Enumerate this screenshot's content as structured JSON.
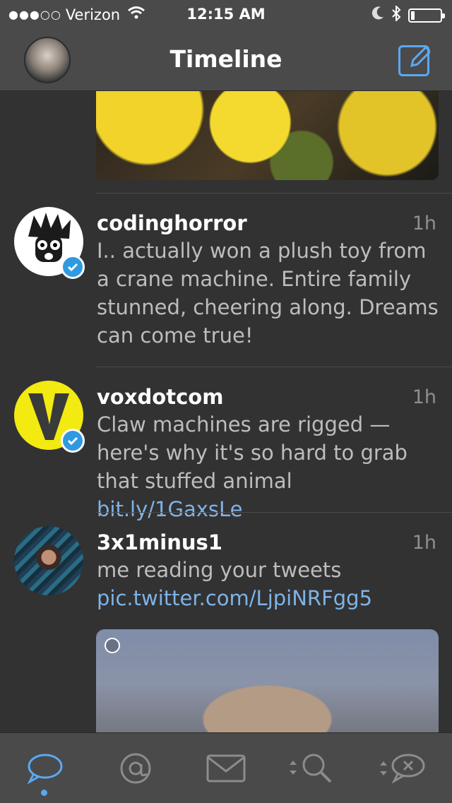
{
  "status": {
    "carrier": "Verizon",
    "signal_dots": "●●●○○",
    "time": "12:15 AM",
    "battery_percent": 12
  },
  "nav": {
    "title": "Timeline"
  },
  "tweets": [
    {
      "username": "codinghorror",
      "time": "1h",
      "text": "I.. actually won a plush toy from a crane machine. Entire family stunned, cheering along. Dreams can come true!",
      "verified": true
    },
    {
      "username": "voxdotcom",
      "time": "1h",
      "text": "Claw machines are rigged — here's why it's so hard to grab that stuffed animal ",
      "link": "bit.ly/1GaxsLe",
      "verified": true
    },
    {
      "username": "3x1minus1",
      "time": "1h",
      "text": "me reading your tweets",
      "link": "pic.twitter.com/LjpiNRFgg5",
      "verified": false
    }
  ],
  "tabs": [
    {
      "icon": "timeline-bubble-icon",
      "active": true
    },
    {
      "icon": "mentions-icon",
      "active": false
    },
    {
      "icon": "messages-icon",
      "active": false
    },
    {
      "icon": "search-icon",
      "active": false
    },
    {
      "icon": "muted-bubble-icon",
      "active": false
    }
  ],
  "colors": {
    "accent": "#5aa9f0",
    "background": "#323233",
    "bar": "#4a4a4b",
    "verified": "#2f9ae0"
  }
}
